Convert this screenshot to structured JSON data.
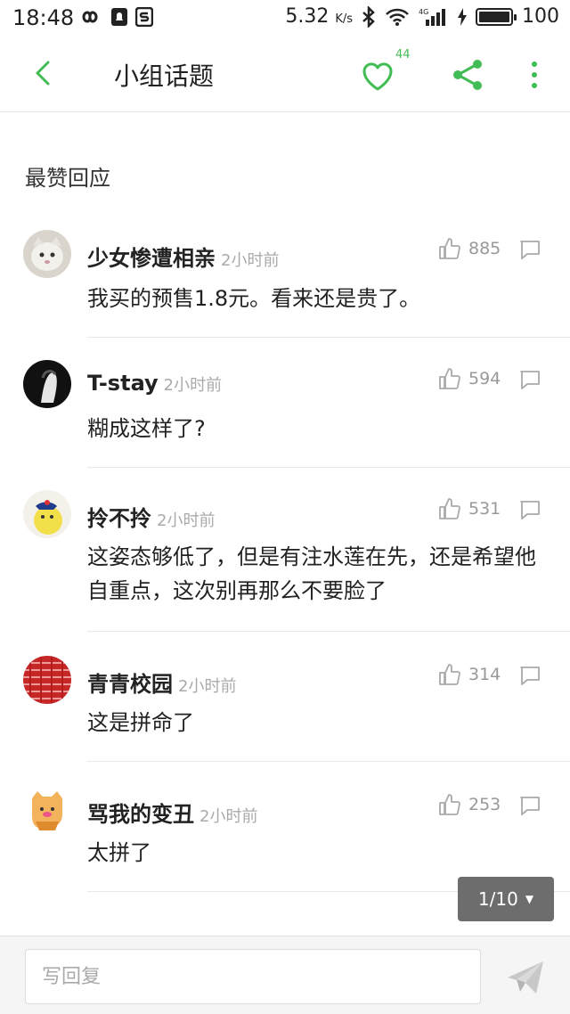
{
  "status_bar": {
    "time": "18:48",
    "speed": "5.32",
    "speed_unit": "K/s",
    "battery": "100",
    "battery_level": 1.0
  },
  "appbar": {
    "title": "小组话题",
    "like_count": "44",
    "accent_color": "#42bd56"
  },
  "section": {
    "title": "最赞回应"
  },
  "comments": [
    {
      "author": "少女惨遭相亲",
      "time": "2小时前",
      "likes": "885",
      "text": "我买的预售1.8元。看来还是贵了。"
    },
    {
      "author": "T-stay",
      "time": "2小时前",
      "likes": "594",
      "text": "糊成这样了?"
    },
    {
      "author": "拎不拎",
      "time": "2小时前",
      "likes": "531",
      "text": "这姿态够低了，但是有注水莲在先，还是希望他自重点，这次别再那么不要脸了"
    },
    {
      "author": "青青校园",
      "time": "2小时前",
      "likes": "314",
      "text": "这是拼命了"
    },
    {
      "author": "骂我的变丑",
      "time": "2小时前",
      "likes": "253",
      "text": "太拼了"
    }
  ],
  "pager": {
    "label": "1/10",
    "caret": "▼"
  },
  "reply_bar": {
    "placeholder": "写回复"
  }
}
